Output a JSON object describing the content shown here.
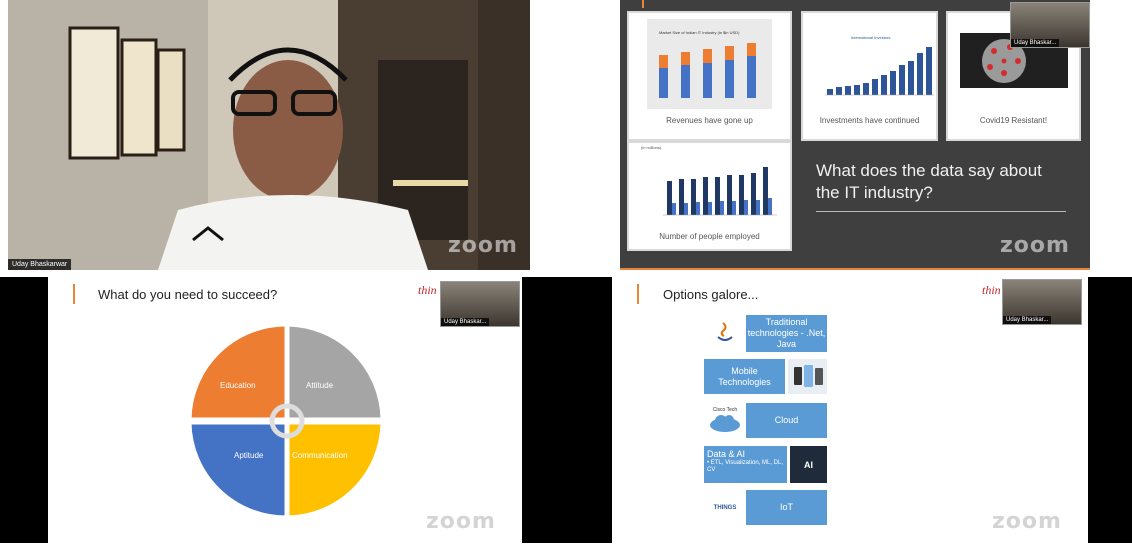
{
  "participant_name": "Uday Bhaskarwar",
  "watermark": "zoom",
  "tile_top_right": {
    "thumb_name": "Uday Bhaskar...",
    "cards": [
      {
        "caption": "Revenues have gone up",
        "chart_title": "Market Size of Indian IT Industry (in $in USD)"
      },
      {
        "caption": "Investments have continued",
        "chart_title": "International Investors"
      },
      {
        "caption": "Covid19 Resistant!"
      },
      {
        "caption": "Number of people employed",
        "chart_title": "(in millions)"
      }
    ],
    "headline": "What does the data say about the IT industry?"
  },
  "tile_bottom_left": {
    "title": "What do you need to succeed?",
    "logo_text": "thin",
    "thumb_name": "Uday Bhaskar...",
    "quadrants": [
      "Education",
      "Attitude",
      "Aptitude",
      "Communication"
    ]
  },
  "tile_bottom_right": {
    "title": "Options galore...",
    "logo_text": "thin",
    "thumb_name": "Uday Bhaskar...",
    "options": [
      {
        "label": "Traditional technologies - .Net, Java",
        "icon": "java-icon"
      },
      {
        "label": "Mobile Technologies",
        "icon": "phones-icon"
      },
      {
        "label": "Cloud",
        "icon": "cloud-icon",
        "icon_text": "Cisco Tech"
      },
      {
        "label": "Data & AI",
        "sub": "• ETL, Visualization, ML, DL, CV",
        "icon": "ai-icon",
        "icon_text": "AI"
      },
      {
        "label": "IoT",
        "icon": "iot-icon",
        "icon_text": "THINGS"
      }
    ]
  },
  "colors": {
    "accent": "#e8873a",
    "education": "#ed7d31",
    "attitude": "#a5a5a5",
    "aptitude": "#4472c4",
    "communication": "#ffc000",
    "option_box": "#5b9bd5"
  }
}
